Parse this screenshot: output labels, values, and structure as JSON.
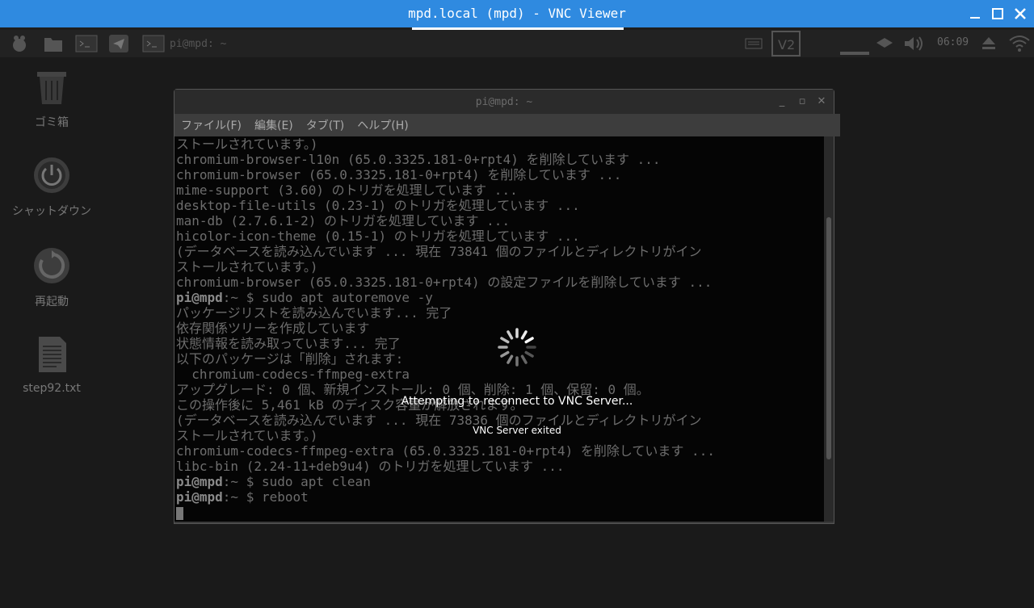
{
  "viewer": {
    "title": "mpd.local (mpd) - VNC Viewer"
  },
  "panel": {
    "task_label": "pi@mpd: ~",
    "clock": "06:09",
    "icons": [
      "raspberry-menu-icon",
      "file-manager-icon",
      "terminal-icon",
      "telegram-icon",
      "terminal-task-icon",
      "keyboard-icon",
      "vnc-icon",
      "network-icon",
      "volume-icon",
      "eject-icon",
      "wifi-icon"
    ]
  },
  "desktop": {
    "icons": [
      {
        "label": "ゴミ箱",
        "icon": "trash-icon"
      },
      {
        "label": "シャットダウン",
        "icon": "power-icon"
      },
      {
        "label": "再起動",
        "icon": "restart-icon"
      },
      {
        "label": "step92.txt",
        "icon": "text-file-icon"
      }
    ]
  },
  "terminal": {
    "title": "pi@mpd: ~",
    "menu": [
      "ファイル(F)",
      "編集(E)",
      "タブ(T)",
      "ヘルプ(H)"
    ],
    "prompt_user": "pi@mpd",
    "lines": [
      {
        "text": "ストールされています。)"
      },
      {
        "text": "chromium-browser-l10n (65.0.3325.181-0+rpt4) を削除しています ..."
      },
      {
        "text": "chromium-browser (65.0.3325.181-0+rpt4) を削除しています ..."
      },
      {
        "text": "mime-support (3.60) のトリガを処理しています ..."
      },
      {
        "text": "desktop-file-utils (0.23-1) のトリガを処理しています ..."
      },
      {
        "text": "man-db (2.7.6.1-2) のトリガを処理しています ..."
      },
      {
        "text": "hicolor-icon-theme (0.15-1) のトリガを処理しています ..."
      },
      {
        "text": "(データベースを読み込んでいます ... 現在 73841 個のファイルとディレクトリがイン"
      },
      {
        "text": "ストールされています。)"
      },
      {
        "text": "chromium-browser (65.0.3325.181-0+rpt4) の設定ファイルを削除しています ..."
      },
      {
        "prompt": true,
        "text": ":~ $ sudo apt autoremove -y"
      },
      {
        "text": "パッケージリストを読み込んでいます... 完了"
      },
      {
        "text": "依存関係ツリーを作成しています"
      },
      {
        "text": "状態情報を読み取っています... 完了"
      },
      {
        "text": "以下のパッケージは「削除」されます:"
      },
      {
        "text": "  chromium-codecs-ffmpeg-extra"
      },
      {
        "text": "アップグレード: 0 個、新規インストール: 0 個、削除: 1 個、保留: 0 個。"
      },
      {
        "text": "この操作後に 5,461 kB のディスク容量が解放されます。"
      },
      {
        "text": "(データベースを読み込んでいます ... 現在 73836 個のファイルとディレクトリがイン"
      },
      {
        "text": "ストールされています。)"
      },
      {
        "text": "chromium-codecs-ffmpeg-extra (65.0.3325.181-0+rpt4) を削除しています ..."
      },
      {
        "text": "libc-bin (2.24-11+deb9u4) のトリガを処理しています ..."
      },
      {
        "prompt": true,
        "text": ":~ $ sudo apt clean"
      },
      {
        "prompt": true,
        "text": ":~ $ reboot"
      },
      {
        "cursor": true,
        "text": ""
      }
    ]
  },
  "overlay": {
    "reconnect_message": "Attempting to reconnect to VNC Server...",
    "exit_message": "VNC Server exited"
  }
}
